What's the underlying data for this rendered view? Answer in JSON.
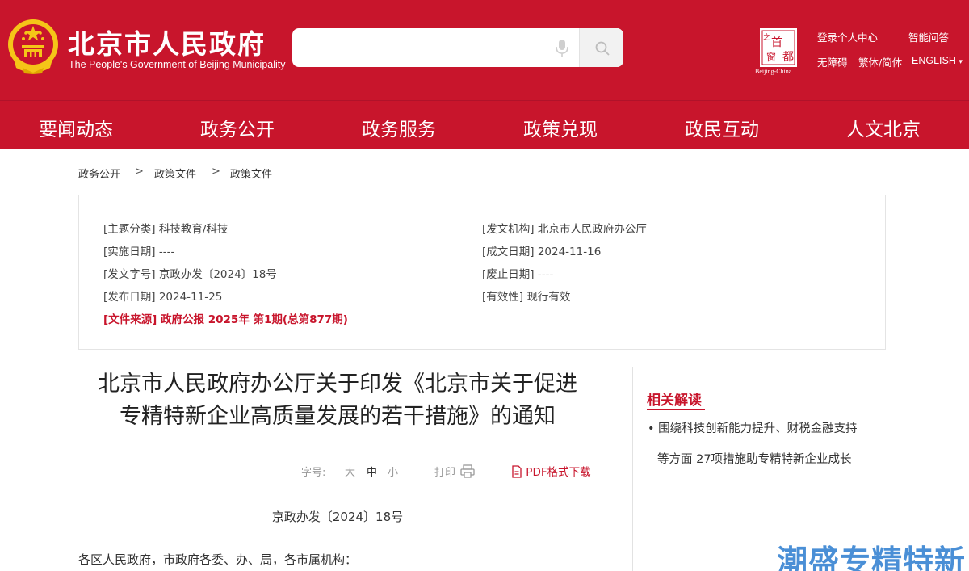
{
  "header": {
    "title": "北京市人民政府",
    "subtitle": "The People's Government of Beijing Municipality",
    "search": {
      "placeholder": "",
      "value": ""
    },
    "capital_logo": {
      "chars": [
        "首",
        "都",
        "之",
        "窗"
      ],
      "caption": "Beijing-China"
    },
    "links": {
      "login": "登录个人中心",
      "assistant": "智能问答",
      "accessibility": "无障碍",
      "traditional": "繁体/简体",
      "english": "ENGLISH",
      "english_arrow": "▾"
    },
    "colors": {
      "brand_red": "#c8152c",
      "gold": "#f5c518"
    }
  },
  "nav": {
    "items": [
      "要闻动态",
      "政务公开",
      "政务服务",
      "政策兑现",
      "政民互动",
      "人文北京"
    ]
  },
  "breadcrumb": {
    "items": [
      "政务公开",
      "政策文件",
      "政策文件"
    ],
    "separator": ">"
  },
  "info": {
    "topic": "[主题分类] 科技教育/科技",
    "issuer": "[发文机构] 北京市人民政府办公厅",
    "effective_date": "[实施日期] ----",
    "written_date": "[成文日期] 2024-11-16",
    "doc_no": "[发文字号] 京政办发〔2024〕18号",
    "repeal_date": "[废止日期] ----",
    "publish_date": "[发布日期] 2024-11-25",
    "validity": "[有效性] 现行有效",
    "source": "[文件来源] 政府公报 2025年 第1期(总第877期)"
  },
  "article": {
    "title_line1": "北京市人民政府办公厅关于印发《北京市关于促进",
    "title_line2": "专精特新企业高质量发展的若干措施》的通知",
    "font_size_label": "字号:",
    "font_large": "大",
    "font_medium": "中",
    "font_small": "小",
    "print_label": "打印",
    "pdf_label": "PDF格式下载",
    "doc_number": "京政办发〔2024〕18号",
    "addressee": "各区人民政府，市政府各委、办、局，各市属机构："
  },
  "sidebar": {
    "related_title": "相关解读",
    "bullet": "•",
    "related_line1": "围绕科技创新能力提升、财税金融支持",
    "related_line2": "等方面 27项措施助专精特新企业成长"
  },
  "watermark": "潮盛专精特新"
}
